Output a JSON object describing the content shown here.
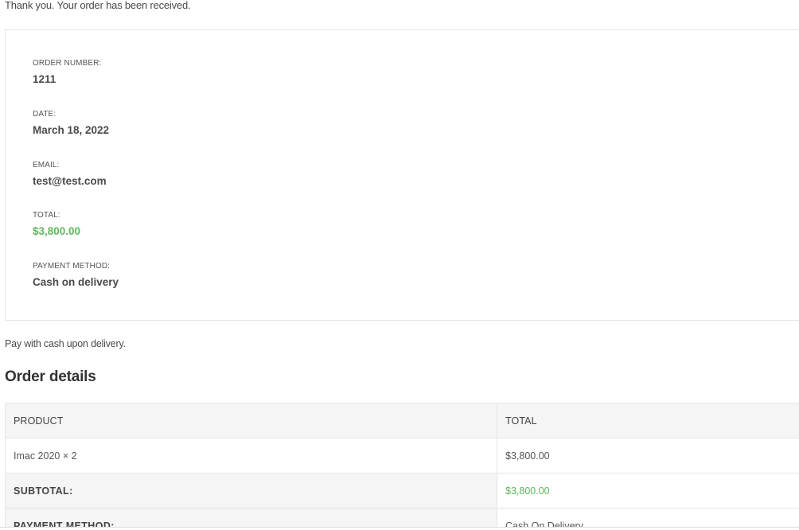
{
  "header": {
    "thanks_message": "Thank you. Your order has been received."
  },
  "overview": {
    "order_number_label": "ORDER NUMBER:",
    "order_number": "1211",
    "date_label": "DATE:",
    "date": "March 18, 2022",
    "email_label": "EMAIL:",
    "email": "test@test.com",
    "total_label": "TOTAL:",
    "total": "$3,800.00",
    "payment_method_label": "PAYMENT METHOD:",
    "payment_method": "Cash on delivery"
  },
  "payment_note": "Pay with cash upon delivery.",
  "order_details": {
    "title": "Order details",
    "columns": [
      "PRODUCT",
      "TOTAL"
    ],
    "items": [
      {
        "product": "Imac 2020",
        "quantity": "× 2",
        "total": "$3,800.00"
      }
    ],
    "footer": [
      {
        "label": "SUBTOTAL:",
        "value": "$3,800.00"
      },
      {
        "label": "PAYMENT METHOD:",
        "value": "Cash On Delivery"
      }
    ]
  },
  "colors": {
    "accent_green": "#5cb85c",
    "border": "#e6e6e6",
    "header_bg": "#f5f5f5"
  }
}
